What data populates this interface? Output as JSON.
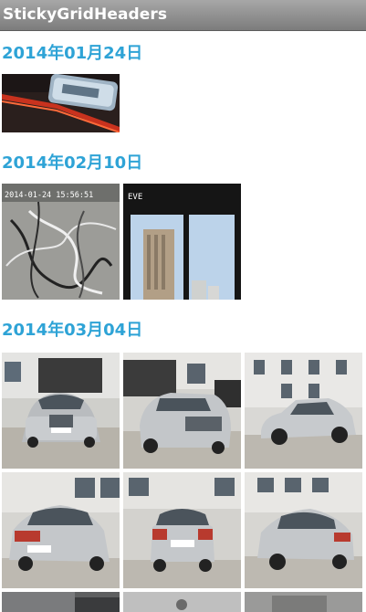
{
  "app": {
    "title": "StickyGridHeaders"
  },
  "sections": [
    {
      "header": "2014年01月24日",
      "item_count": 1
    },
    {
      "header": "2014年02月10日",
      "item_count": 2
    },
    {
      "header": "2014年03月04日",
      "item_count": 9
    }
  ],
  "photos": {
    "cam_timestamp": "2014-01-24 15:56:51",
    "cam_label": "EVE"
  },
  "colors": {
    "title_bar": "#8f8f8f",
    "header_text": "#2ea3d6",
    "background": "#ffffff"
  }
}
